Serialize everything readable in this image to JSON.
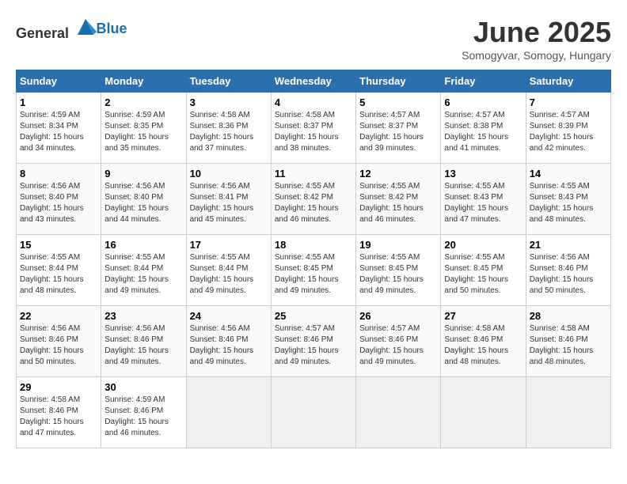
{
  "header": {
    "logo_general": "General",
    "logo_blue": "Blue",
    "month": "June 2025",
    "location": "Somogyvar, Somogy, Hungary"
  },
  "weekdays": [
    "Sunday",
    "Monday",
    "Tuesday",
    "Wednesday",
    "Thursday",
    "Friday",
    "Saturday"
  ],
  "weeks": [
    [
      {
        "day": "1",
        "info": "Sunrise: 4:59 AM\nSunset: 8:34 PM\nDaylight: 15 hours\nand 34 minutes."
      },
      {
        "day": "2",
        "info": "Sunrise: 4:59 AM\nSunset: 8:35 PM\nDaylight: 15 hours\nand 35 minutes."
      },
      {
        "day": "3",
        "info": "Sunrise: 4:58 AM\nSunset: 8:36 PM\nDaylight: 15 hours\nand 37 minutes."
      },
      {
        "day": "4",
        "info": "Sunrise: 4:58 AM\nSunset: 8:37 PM\nDaylight: 15 hours\nand 38 minutes."
      },
      {
        "day": "5",
        "info": "Sunrise: 4:57 AM\nSunset: 8:37 PM\nDaylight: 15 hours\nand 39 minutes."
      },
      {
        "day": "6",
        "info": "Sunrise: 4:57 AM\nSunset: 8:38 PM\nDaylight: 15 hours\nand 41 minutes."
      },
      {
        "day": "7",
        "info": "Sunrise: 4:57 AM\nSunset: 8:39 PM\nDaylight: 15 hours\nand 42 minutes."
      }
    ],
    [
      {
        "day": "8",
        "info": "Sunrise: 4:56 AM\nSunset: 8:40 PM\nDaylight: 15 hours\nand 43 minutes."
      },
      {
        "day": "9",
        "info": "Sunrise: 4:56 AM\nSunset: 8:40 PM\nDaylight: 15 hours\nand 44 minutes."
      },
      {
        "day": "10",
        "info": "Sunrise: 4:56 AM\nSunset: 8:41 PM\nDaylight: 15 hours\nand 45 minutes."
      },
      {
        "day": "11",
        "info": "Sunrise: 4:55 AM\nSunset: 8:42 PM\nDaylight: 15 hours\nand 46 minutes."
      },
      {
        "day": "12",
        "info": "Sunrise: 4:55 AM\nSunset: 8:42 PM\nDaylight: 15 hours\nand 46 minutes."
      },
      {
        "day": "13",
        "info": "Sunrise: 4:55 AM\nSunset: 8:43 PM\nDaylight: 15 hours\nand 47 minutes."
      },
      {
        "day": "14",
        "info": "Sunrise: 4:55 AM\nSunset: 8:43 PM\nDaylight: 15 hours\nand 48 minutes."
      }
    ],
    [
      {
        "day": "15",
        "info": "Sunrise: 4:55 AM\nSunset: 8:44 PM\nDaylight: 15 hours\nand 48 minutes."
      },
      {
        "day": "16",
        "info": "Sunrise: 4:55 AM\nSunset: 8:44 PM\nDaylight: 15 hours\nand 49 minutes."
      },
      {
        "day": "17",
        "info": "Sunrise: 4:55 AM\nSunset: 8:44 PM\nDaylight: 15 hours\nand 49 minutes."
      },
      {
        "day": "18",
        "info": "Sunrise: 4:55 AM\nSunset: 8:45 PM\nDaylight: 15 hours\nand 49 minutes."
      },
      {
        "day": "19",
        "info": "Sunrise: 4:55 AM\nSunset: 8:45 PM\nDaylight: 15 hours\nand 49 minutes."
      },
      {
        "day": "20",
        "info": "Sunrise: 4:55 AM\nSunset: 8:45 PM\nDaylight: 15 hours\nand 50 minutes."
      },
      {
        "day": "21",
        "info": "Sunrise: 4:56 AM\nSunset: 8:46 PM\nDaylight: 15 hours\nand 50 minutes."
      }
    ],
    [
      {
        "day": "22",
        "info": "Sunrise: 4:56 AM\nSunset: 8:46 PM\nDaylight: 15 hours\nand 50 minutes."
      },
      {
        "day": "23",
        "info": "Sunrise: 4:56 AM\nSunset: 8:46 PM\nDaylight: 15 hours\nand 49 minutes."
      },
      {
        "day": "24",
        "info": "Sunrise: 4:56 AM\nSunset: 8:46 PM\nDaylight: 15 hours\nand 49 minutes."
      },
      {
        "day": "25",
        "info": "Sunrise: 4:57 AM\nSunset: 8:46 PM\nDaylight: 15 hours\nand 49 minutes."
      },
      {
        "day": "26",
        "info": "Sunrise: 4:57 AM\nSunset: 8:46 PM\nDaylight: 15 hours\nand 49 minutes."
      },
      {
        "day": "27",
        "info": "Sunrise: 4:58 AM\nSunset: 8:46 PM\nDaylight: 15 hours\nand 48 minutes."
      },
      {
        "day": "28",
        "info": "Sunrise: 4:58 AM\nSunset: 8:46 PM\nDaylight: 15 hours\nand 48 minutes."
      }
    ],
    [
      {
        "day": "29",
        "info": "Sunrise: 4:58 AM\nSunset: 8:46 PM\nDaylight: 15 hours\nand 47 minutes."
      },
      {
        "day": "30",
        "info": "Sunrise: 4:59 AM\nSunset: 8:46 PM\nDaylight: 15 hours\nand 46 minutes."
      },
      {
        "day": "",
        "info": ""
      },
      {
        "day": "",
        "info": ""
      },
      {
        "day": "",
        "info": ""
      },
      {
        "day": "",
        "info": ""
      },
      {
        "day": "",
        "info": ""
      }
    ]
  ]
}
